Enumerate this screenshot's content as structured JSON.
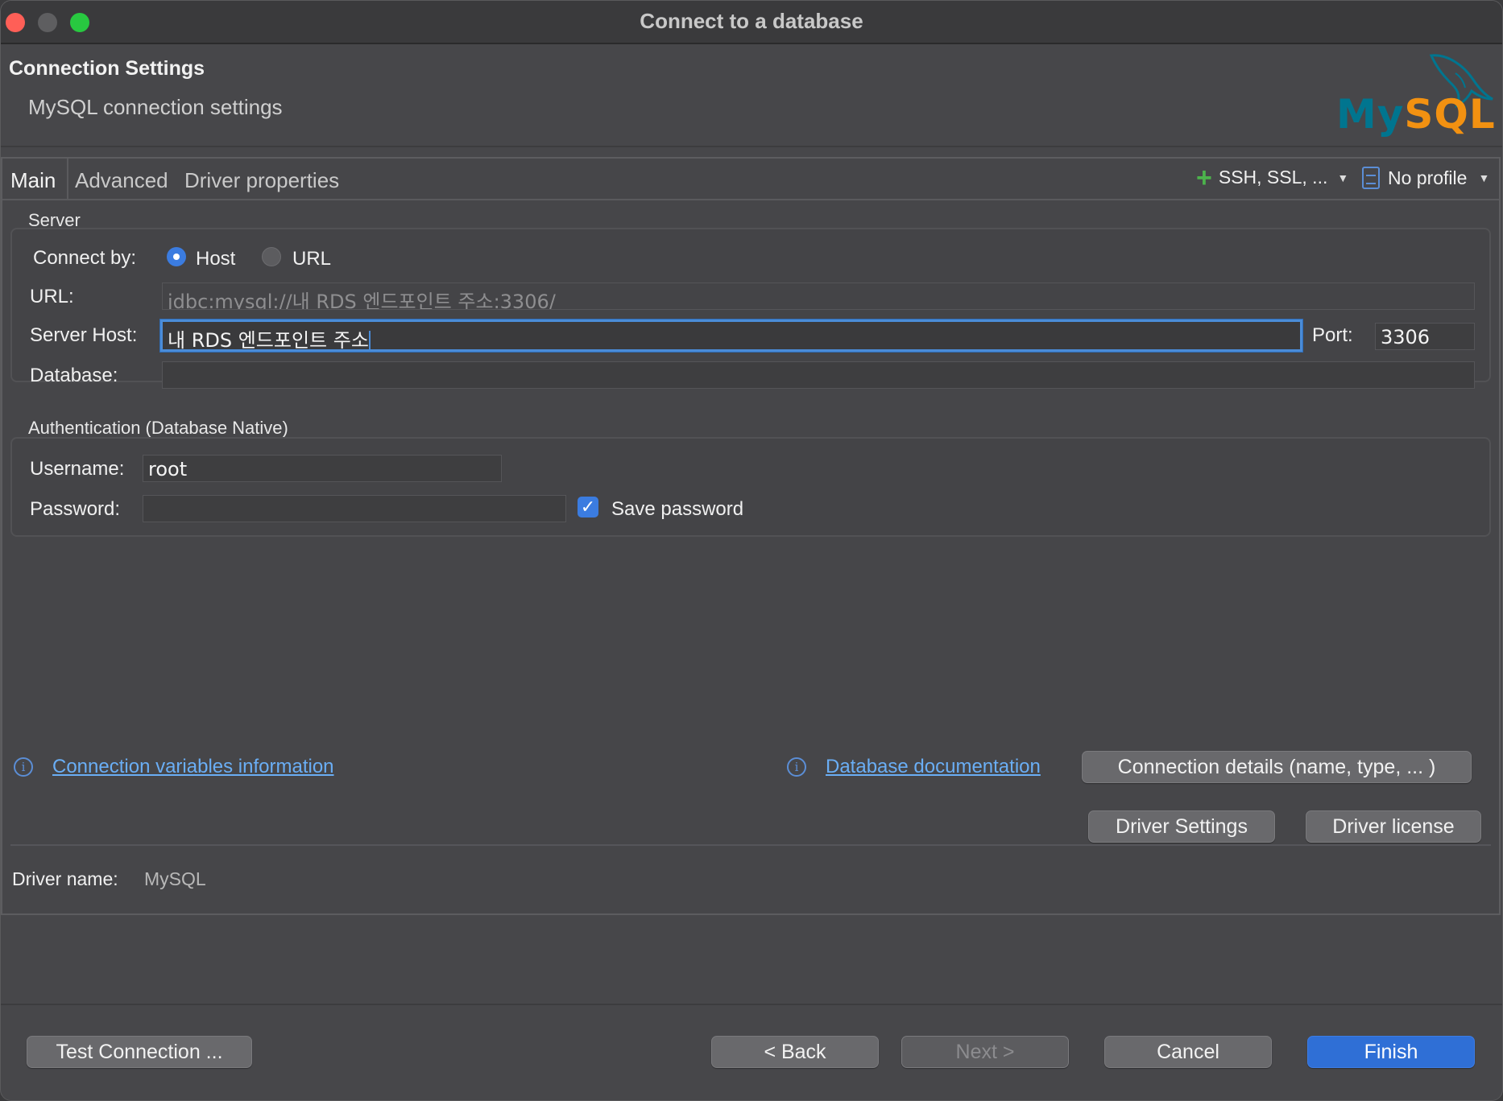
{
  "window": {
    "title": "Connect to a database"
  },
  "header": {
    "title": "Connection Settings",
    "subtitle": "MySQL connection settings",
    "logo": {
      "my": "My",
      "sql": "SQL",
      "brand_colors": {
        "my": "#00758f",
        "sql": "#f29111"
      }
    }
  },
  "tabs": [
    {
      "label": "Main",
      "active": true
    },
    {
      "label": "Advanced",
      "active": false
    },
    {
      "label": "Driver properties",
      "active": false
    }
  ],
  "toolbar": {
    "ssh_label": "SSH, SSL, ...",
    "profile_label": "No profile"
  },
  "server": {
    "group_label": "Server",
    "connect_by_label": "Connect by:",
    "options": [
      {
        "label": "Host",
        "selected": true
      },
      {
        "label": "URL",
        "selected": false
      }
    ],
    "url_label": "URL:",
    "url_value": "jdbc:mysql://내 RDS 엔드포인트 주소:3306/",
    "host_label": "Server Host:",
    "host_value": "내 RDS 엔드포인트 주소",
    "port_label": "Port:",
    "port_value": "3306",
    "database_label": "Database:",
    "database_value": ""
  },
  "auth": {
    "group_label": "Authentication (Database Native)",
    "username_label": "Username:",
    "username_value": "root",
    "password_label": "Password:",
    "password_value": "",
    "save_password_label": "Save password",
    "save_password_checked": true
  },
  "links": {
    "conn_vars": "Connection variables information",
    "db_docs": "Database documentation"
  },
  "buttons": {
    "conn_details": "Connection details (name, type, ... )",
    "driver_settings": "Driver Settings",
    "driver_license": "Driver license",
    "test_connection": "Test Connection ...",
    "back": "< Back",
    "next": "Next >",
    "cancel": "Cancel",
    "finish": "Finish"
  },
  "driver": {
    "label": "Driver name:",
    "value": "MySQL"
  },
  "colors": {
    "accent": "#2f6fd6",
    "link": "#6aaef5",
    "add": "#4cb34c"
  }
}
